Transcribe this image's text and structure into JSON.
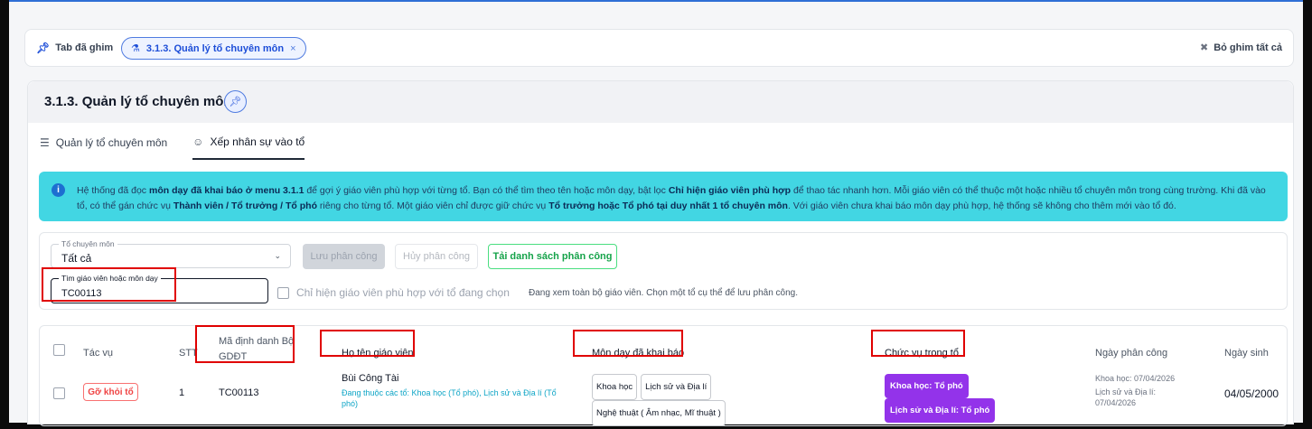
{
  "pinbar": {
    "label": "Tab đã ghim",
    "chip": "3.1.3. Quản lý tổ chuyên môn",
    "chip_close": "×",
    "unpin_all": "Bỏ ghim tất cả"
  },
  "page": {
    "title": "3.1.3. Quản lý tổ chuyên môn"
  },
  "tabs": [
    {
      "label": "Quản lý tổ chuyên môn"
    },
    {
      "label": "Xếp nhân sự vào tổ"
    }
  ],
  "info": {
    "p1": "Hệ thống đã đọc ",
    "b1": "môn dạy đã khai báo ở menu 3.1.1",
    "p2": " để gợi ý giáo viên phù hợp với từng tổ. Bạn có thể tìm theo tên hoặc môn dạy, bật lọc ",
    "b2": "Chỉ hiện giáo viên phù hợp",
    "p3": " để thao tác nhanh hơn. Mỗi giáo viên có thể thuộc một hoặc nhiều tổ chuyên môn trong cùng trường. Khi đã vào tổ, có thể gán chức vụ ",
    "b3": "Thành viên / Tổ trưởng / Tổ phó",
    "p4": " riêng cho từng tổ. Một giáo viên chỉ được giữ chức vụ ",
    "b4": "Tổ trưởng hoặc Tổ phó tại duy nhất 1 tổ chuyên môn",
    "p5": ". Với giáo viên chưa khai báo môn dạy phù hợp, hệ thống sẽ không cho thêm mới vào tổ đó."
  },
  "filter": {
    "group_label": "Tổ chuyên môn",
    "group_value": "Tất cả",
    "save_label": "Lưu phân công",
    "cancel_label": "Hủy phân công",
    "reload_label": "Tải danh sách phân công",
    "search_label": "Tìm giáo viên hoặc môn dạy",
    "search_value": "TC00113",
    "only_match_label": "Chỉ hiện giáo viên phù hợp với tổ đang chọn",
    "hint": "Đang xem toàn bộ giáo viên. Chọn một tổ cụ thể để lưu phân công."
  },
  "table": {
    "headers": {
      "action": "Tác vụ",
      "stt": "STT",
      "code_l1": "Mã định danh Bộ",
      "code_l2": "GDĐT",
      "name": "Họ tên giáo viên",
      "subjects": "Môn dạy đã khai báo",
      "role": "Chức vụ trong tổ",
      "assigned": "Ngày phân công",
      "dob": "Ngày sinh"
    },
    "rows": [
      {
        "action": "Gỡ khỏi tổ",
        "stt": "1",
        "code": "TC00113",
        "name": "Bùi Công Tài",
        "groups_l1": "Đang thuộc các tổ: Khoa học (Tổ phó), Lịch sử và Địa lí (Tổ",
        "groups_l2": "phó)",
        "subjects": [
          "Khoa học",
          "Lịch sử và Địa lí",
          "Nghệ thuật ( Âm nhạc, Mĩ thuật )"
        ],
        "roles": [
          "Khoa học: Tổ phó",
          "Lịch sử và Địa lí: Tổ phó"
        ],
        "assigned_l1": "Khoa học: 07/04/2026",
        "assigned_l2": "Lịch sử và Địa lí:",
        "assigned_l3": "07/04/2026",
        "dob": "04/05/2000"
      }
    ]
  },
  "colors": {
    "accent": "#1d4ed8",
    "info_bg": "#42d6e3",
    "role_badge": "#9333ea",
    "highlight": "#e00000",
    "success": "#16a34a",
    "danger": "#ef4444"
  }
}
